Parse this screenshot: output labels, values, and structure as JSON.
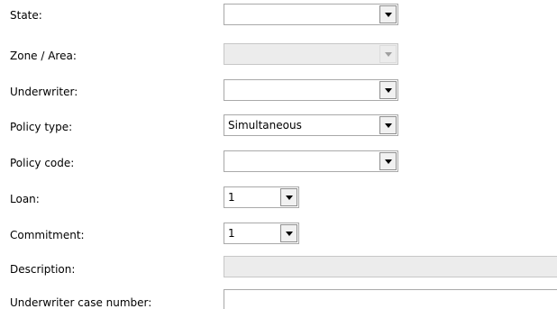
{
  "fields": {
    "state": {
      "label": "State:",
      "value": ""
    },
    "zone_area": {
      "label": "Zone / Area:",
      "value": ""
    },
    "underwriter": {
      "label": "Underwriter:",
      "value": ""
    },
    "policy_type": {
      "label": "Policy type:",
      "value": "Simultaneous"
    },
    "policy_code": {
      "label": "Policy code:",
      "value": ""
    },
    "loan": {
      "label": "Loan:",
      "value": "1"
    },
    "commitment": {
      "label": "Commitment:",
      "value": "1"
    },
    "description": {
      "label": "Description:",
      "value": ""
    },
    "underwriter_case_number": {
      "label": "Underwriter case number:",
      "value": ""
    }
  },
  "icons": {
    "dropdown": "chevron-down-icon"
  },
  "colors": {
    "disabled_background": "#ececec",
    "border": "#a9a9a9"
  }
}
